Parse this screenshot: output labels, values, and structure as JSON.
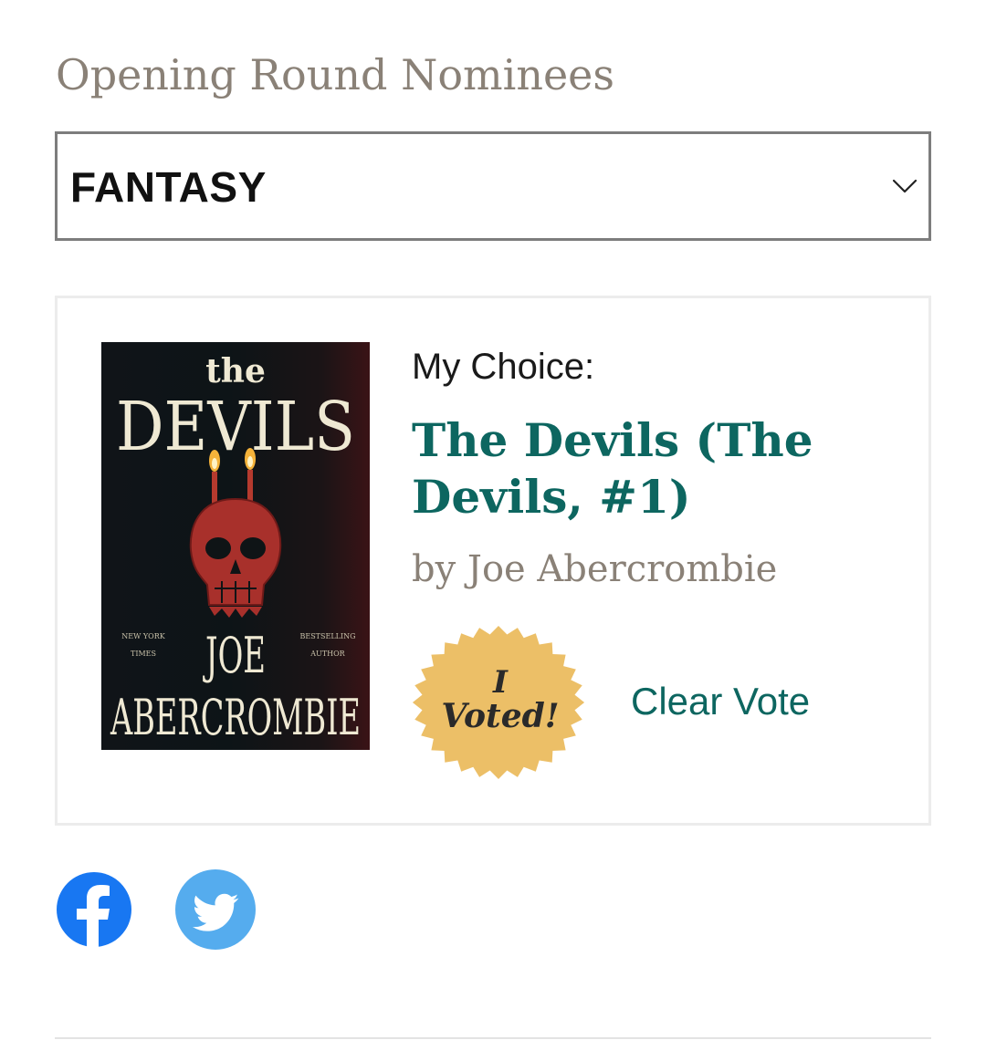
{
  "section": {
    "heading": "Opening Round Nominees"
  },
  "category_select": {
    "selected": "FANTASY",
    "icon": "chevron-down-icon"
  },
  "nominee": {
    "cover": {
      "top_text": "the",
      "title_text": "DEVILS",
      "author_first": "JOE",
      "author_last": "ABERCROMBIE",
      "tagline_left": [
        "NEW YORK",
        "TIMES"
      ],
      "tagline_right": [
        "BESTSELLING",
        "AUTHOR"
      ],
      "icon": "skull-icon"
    },
    "choice_label": "My Choice:",
    "title": "The Devils (The Devils, #1)",
    "author": "by Joe Abercrombie",
    "badge": {
      "line1": "I",
      "line2": "Voted!",
      "color": "#ecbf67",
      "icon": "seal-badge-icon"
    },
    "clear_vote_label": "Clear Vote"
  },
  "share": {
    "facebook": {
      "icon": "facebook-icon",
      "color": "#1877f2"
    },
    "twitter": {
      "icon": "twitter-icon",
      "color": "#55acee"
    }
  },
  "colors": {
    "accent": "#0d6660",
    "muted_text": "#8a8177",
    "select_border": "#7d7d7d",
    "card_border": "#ececec"
  }
}
